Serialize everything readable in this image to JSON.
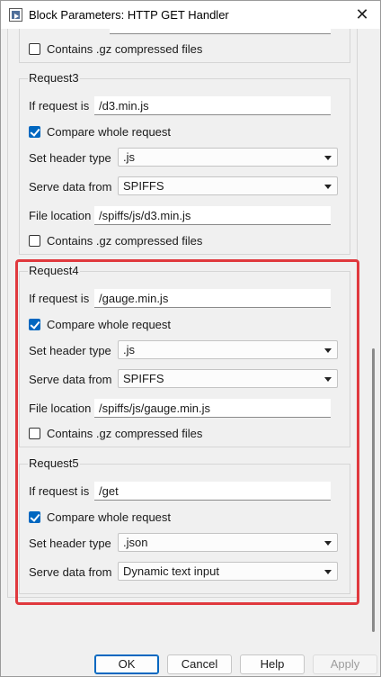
{
  "window": {
    "title": "Block Parameters: HTTP GET Handler"
  },
  "request_prev": {
    "gz_label": "Contains .gz compressed files",
    "gz_checked": false
  },
  "request3": {
    "title": "Request3",
    "if_label": "If request is",
    "if_value": "/d3.min.js",
    "compare_label": "Compare whole request",
    "compare_checked": true,
    "header_label": "Set header type",
    "header_value": ".js",
    "serve_label": "Serve data from",
    "serve_value": "SPIFFS",
    "file_label": "File location",
    "file_value": "/spiffs/js/d3.min.js",
    "gz_label": "Contains .gz compressed files",
    "gz_checked": false
  },
  "request4": {
    "title": "Request4",
    "if_label": "If request is",
    "if_value": "/gauge.min.js",
    "compare_label": "Compare whole request",
    "compare_checked": true,
    "header_label": "Set header type",
    "header_value": ".js",
    "serve_label": "Serve data from",
    "serve_value": "SPIFFS",
    "file_label": "File location",
    "file_value": "/spiffs/js/gauge.min.js",
    "gz_label": "Contains .gz compressed files",
    "gz_checked": false
  },
  "request5": {
    "title": "Request5",
    "if_label": "If request is",
    "if_value": "/get",
    "compare_label": "Compare whole request",
    "compare_checked": true,
    "header_label": "Set header type",
    "header_value": ".json",
    "serve_label": "Serve data from",
    "serve_value": "Dynamic text input"
  },
  "footer": {
    "ok": "OK",
    "cancel": "Cancel",
    "help": "Help",
    "apply": "Apply"
  },
  "colors": {
    "highlight": "#e0393e",
    "checkbox": "#0067c0"
  }
}
